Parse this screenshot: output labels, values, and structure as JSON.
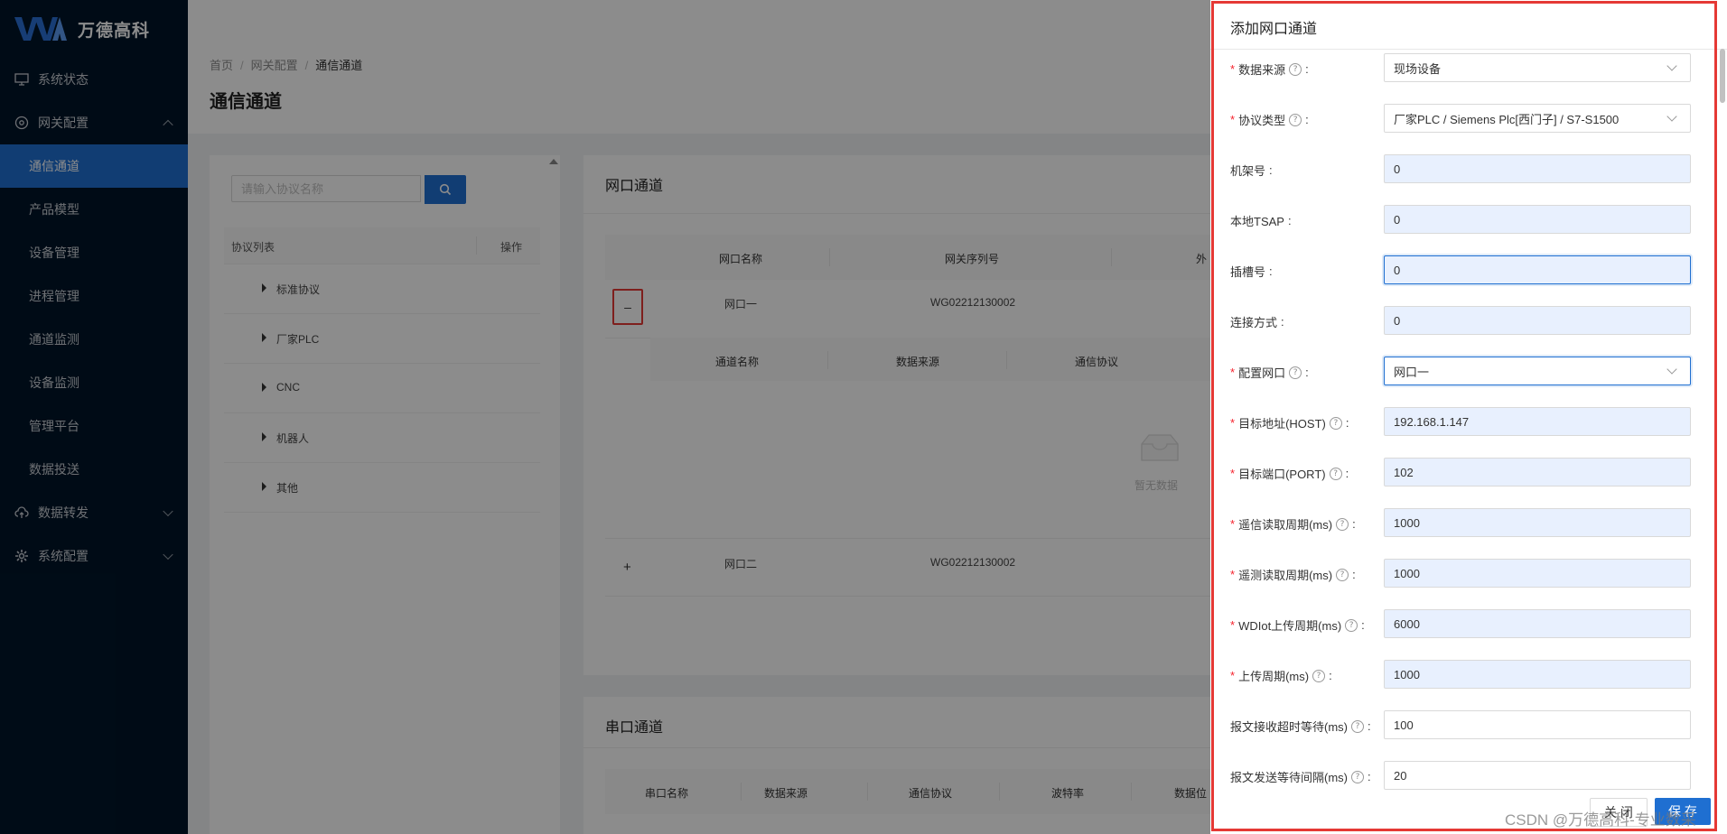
{
  "brand": {
    "name": "万德高科"
  },
  "sidebar": {
    "items": [
      {
        "label": "系统状态",
        "icon": "monitor-icon"
      },
      {
        "label": "网关配置",
        "icon": "gateway-icon",
        "expanded": true,
        "children": [
          "通信通道",
          "产品模型",
          "设备管理",
          "进程管理",
          "通道监测",
          "设备监测",
          "管理平台",
          "数据投送"
        ],
        "active_child": "通信通道"
      },
      {
        "label": "数据转发",
        "icon": "cloud-upload-icon"
      },
      {
        "label": "系统配置",
        "icon": "gear-icon"
      }
    ]
  },
  "breadcrumb": [
    "首页",
    "网关配置",
    "通信通道"
  ],
  "page_title": "通信通道",
  "protocol_panel": {
    "search_placeholder": "请输入协议名称",
    "col_list": "协议列表",
    "col_action": "操作",
    "groups": [
      "标准协议",
      "厂家PLC",
      "CNC",
      "机器人",
      "其他"
    ]
  },
  "network_card": {
    "title": "网口通道",
    "columns": [
      "网口名称",
      "网关序列号",
      "外"
    ],
    "rows": [
      {
        "name": "网口一",
        "serial": "WG02212130002",
        "toggle": "–"
      },
      {
        "name": "网口二",
        "serial": "WG02212130002",
        "toggle": "+"
      }
    ],
    "sub_columns": [
      "通道名称",
      "数据来源",
      "通信协议"
    ],
    "empty_text": "暂无数据"
  },
  "serial_card": {
    "title": "串口通道",
    "columns": [
      "串口名称",
      "数据来源",
      "通信协议",
      "波特率",
      "数据位"
    ]
  },
  "drawer": {
    "title": "添加网口通道",
    "fields": [
      {
        "label": "数据来源",
        "required": true,
        "help": true,
        "type": "select",
        "value": "现场设备"
      },
      {
        "label": "协议类型",
        "required": true,
        "help": true,
        "type": "select",
        "value": "厂家PLC / Siemens Plc[西门子] / S7-S1500"
      },
      {
        "label": "机架号",
        "required": false,
        "help": false,
        "type": "input",
        "value": "0"
      },
      {
        "label": "本地TSAP",
        "required": false,
        "help": false,
        "type": "input",
        "value": "0"
      },
      {
        "label": "插槽号",
        "required": false,
        "help": false,
        "type": "input",
        "value": "0"
      },
      {
        "label": "连接方式",
        "required": false,
        "help": false,
        "type": "input",
        "value": "0"
      },
      {
        "label": "配置网口",
        "required": true,
        "help": true,
        "type": "select",
        "value": "网口一"
      },
      {
        "label": "目标地址(HOST)",
        "required": true,
        "help": true,
        "type": "input",
        "value": "192.168.1.147"
      },
      {
        "label": "目标端口(PORT)",
        "required": true,
        "help": true,
        "type": "input",
        "value": "102"
      },
      {
        "label": "遥信读取周期(ms)",
        "required": true,
        "help": true,
        "type": "input",
        "value": "1000"
      },
      {
        "label": "遥测读取周期(ms)",
        "required": true,
        "help": true,
        "type": "input",
        "value": "1000"
      },
      {
        "label": "WDIot上传周期(ms)",
        "required": true,
        "help": true,
        "type": "input",
        "value": "6000"
      },
      {
        "label": "上传周期(ms)",
        "required": true,
        "help": true,
        "type": "input",
        "value": "1000"
      },
      {
        "label": "报文接收超时等待(ms)",
        "required": false,
        "help": true,
        "type": "input",
        "value": "100"
      },
      {
        "label": "报文发送等待间隔(ms)",
        "required": false,
        "help": true,
        "type": "input",
        "value": "20"
      }
    ],
    "close_label": "关 闭",
    "save_label": "保 存"
  },
  "watermark": "CSDN @万德高科-专业数采",
  "colors": {
    "primary": "#1f6fd1",
    "sidebar_bg": "#001529",
    "highlight": "#e53935",
    "required": "#f5222d"
  }
}
